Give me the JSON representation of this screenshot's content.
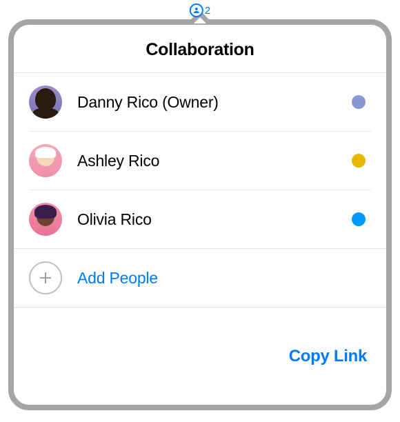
{
  "badge": {
    "count": "2"
  },
  "header": {
    "title": "Collaboration"
  },
  "participants": [
    {
      "name": "Danny Rico (Owner)",
      "avatar_class": "avatar-1",
      "status_color": "#8a98d1"
    },
    {
      "name": "Ashley Rico",
      "avatar_class": "avatar-2",
      "status_color": "#e6b800"
    },
    {
      "name": "Olivia Rico",
      "avatar_class": "avatar-3",
      "status_color": "#0099ff"
    }
  ],
  "actions": {
    "add_people_label": "Add People",
    "copy_link_label": "Copy Link"
  }
}
